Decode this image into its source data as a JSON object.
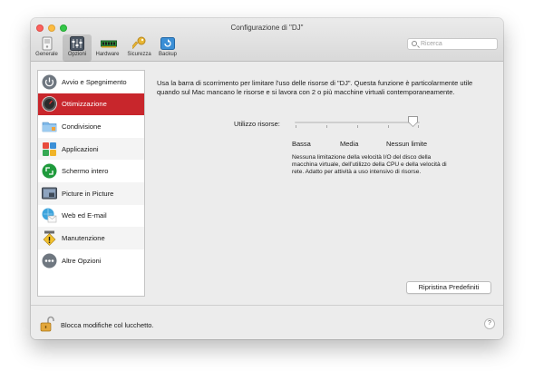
{
  "window": {
    "title": "Configurazione di \"DJ\""
  },
  "toolbar": {
    "items": [
      {
        "label": "Generale",
        "icon": "general-icon"
      },
      {
        "label": "Opzioni",
        "icon": "options-icon",
        "selected": true
      },
      {
        "label": "Hardware",
        "icon": "hardware-icon"
      },
      {
        "label": "Sicurezza",
        "icon": "key-icon"
      },
      {
        "label": "Backup",
        "icon": "backup-icon"
      }
    ],
    "search_placeholder": "Ricerca"
  },
  "sidebar": {
    "items": [
      {
        "label": "Avvio e Spegnimento",
        "icon": "power-icon"
      },
      {
        "label": "Ottimizzazione",
        "icon": "speedometer-icon",
        "active": true
      },
      {
        "label": "Condivisione",
        "icon": "folder-icon"
      },
      {
        "label": "Applicazioni",
        "icon": "apps-icon"
      },
      {
        "label": "Schermo intero",
        "icon": "fullscreen-icon"
      },
      {
        "label": "Picture in Picture",
        "icon": "picture-in-picture-icon"
      },
      {
        "label": "Web ed E-mail",
        "icon": "web-email-icon"
      },
      {
        "label": "Manutenzione",
        "icon": "maintenance-icon"
      },
      {
        "label": "Altre Opzioni",
        "icon": "more-icon"
      }
    ]
  },
  "main": {
    "description": "Usa la barra di scorrimento per limitare l'uso delle risorse di \"DJ\". Questa funzione è particolarmente utile quando sul Mac mancano le risorse e si lavora con 2 o più macchine virtuali contemporaneamente.",
    "resource_label": "Utilizzo risorse:",
    "resource_level": "Nessun limite",
    "resource_position": 1.0,
    "scale": {
      "low": "Bassa",
      "mid": "Media",
      "high": "Nessun limite"
    },
    "note": "Nessuna limitazione della velocità I/O del disco della macchina virtuale, dell'utilizzo della CPU e della velocità di rete. Adatto per attività a uso intensivo di risorse.",
    "restore_button": "Ripristina Predefiniti"
  },
  "bottom": {
    "lock_text": "Blocca modifiche col lucchetto.",
    "help": "?"
  },
  "colors": {
    "accent": "#c8262c"
  }
}
